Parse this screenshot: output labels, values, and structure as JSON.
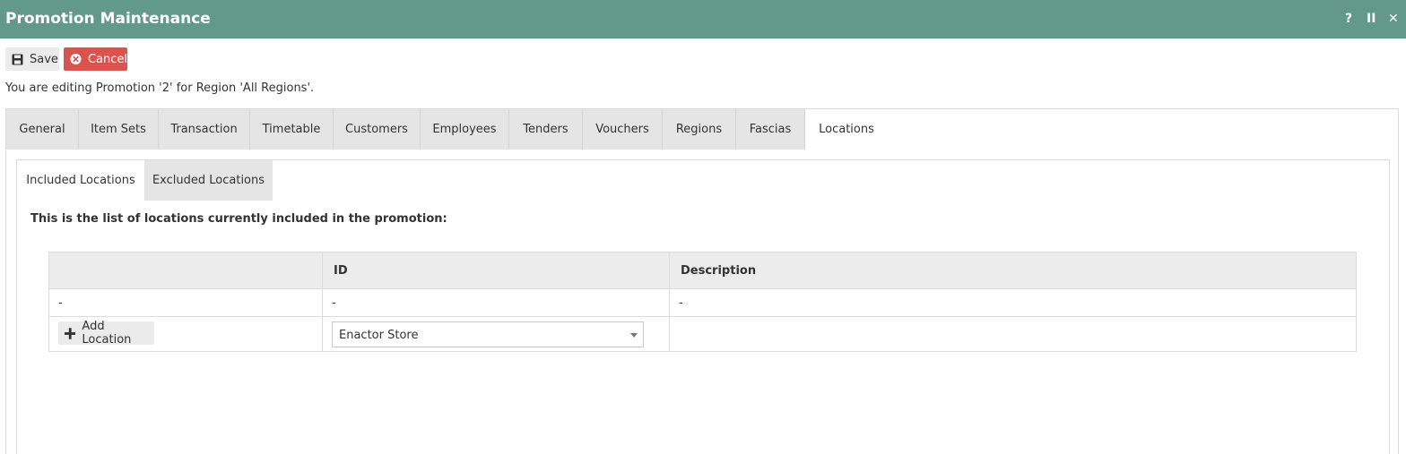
{
  "window": {
    "title": "Promotion Maintenance",
    "controls": [
      "?",
      "II",
      "✕"
    ]
  },
  "toolbar": {
    "save_label": "Save",
    "cancel_label": "Cancel"
  },
  "notice": "You are editing Promotion '2' for Region 'All Regions'.",
  "tabs": [
    {
      "label": "General"
    },
    {
      "label": "Item Sets"
    },
    {
      "label": "Transaction"
    },
    {
      "label": "Timetable"
    },
    {
      "label": "Customers"
    },
    {
      "label": "Employees"
    },
    {
      "label": "Tenders"
    },
    {
      "label": "Vouchers"
    },
    {
      "label": "Regions"
    },
    {
      "label": "Fascias"
    },
    {
      "label": "Locations"
    }
  ],
  "subtabs": [
    {
      "label": "Included Locations"
    },
    {
      "label": "Excluded Locations"
    }
  ],
  "description": "This is the list of locations currently included in the promotion:",
  "table": {
    "columns": [
      "",
      "ID",
      "Description"
    ],
    "rows": [
      [
        "-",
        "-",
        "-"
      ]
    ],
    "add_label": "Add Location",
    "location_select": "Enactor Store"
  },
  "colors": {
    "titlebar": "#62998a",
    "cancel": "#d9534f"
  }
}
